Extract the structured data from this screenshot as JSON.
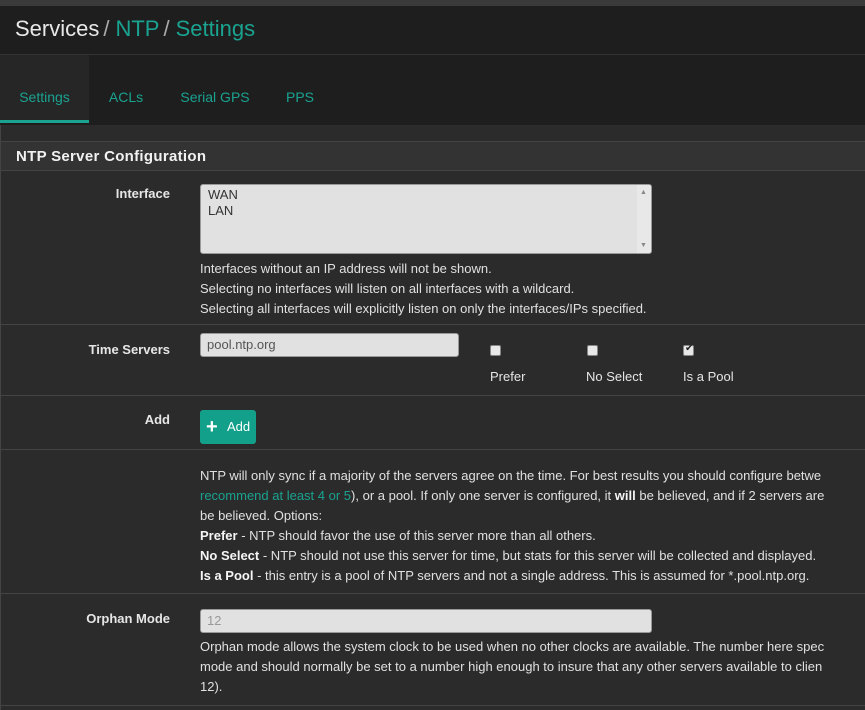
{
  "breadcrumb": {
    "root": "Services",
    "sep1": "/",
    "ntp": "NTP",
    "sep2": "/",
    "settings": "Settings"
  },
  "tabs": [
    "Settings",
    "ACLs",
    "Serial GPS",
    "PPS"
  ],
  "panel_title": "NTP Server Configuration",
  "interface": {
    "label": "Interface",
    "options": [
      "WAN",
      "LAN"
    ],
    "help": [
      "Interfaces without an IP address will not be shown.",
      "Selecting no interfaces will listen on all interfaces with a wildcard.",
      "Selecting all interfaces will explicitly listen on only the interfaces/IPs specified."
    ]
  },
  "time_servers": {
    "label": "Time Servers",
    "value": "pool.ntp.org",
    "prefer_label": "Prefer",
    "noselect_label": "No Select",
    "pool_label": "Is a Pool",
    "prefer_checked": false,
    "noselect_checked": false,
    "pool_checked": true
  },
  "add": {
    "label": "Add",
    "button": "Add",
    "icon": "plus-icon"
  },
  "ntp_help": {
    "line1": "NTP will only sync if a majority of the servers agree on the time. For best results you should configure betwe",
    "line2_link": "recommend at least 4 or 5",
    "line2_rest_a": "), or a pool. If only one server is configured, it ",
    "line2_bold": "will",
    "line2_rest_b": " be believed, and if 2 servers are",
    "line3": "be believed. Options:",
    "prefer_b": "Prefer",
    "prefer_t": " - NTP should favor the use of this server more than all others.",
    "noselect_b": "No Select",
    "noselect_t": " - NTP should not use this server for time, but stats for this server will be collected and displayed.",
    "pool_b": "Is a Pool",
    "pool_t": " - this entry is a pool of NTP servers and not a single address. This is assumed for *.pool.ntp.org."
  },
  "orphan": {
    "label": "Orphan Mode",
    "placeholder": "12",
    "help1": "Orphan mode allows the system clock to be used when no other clocks are available. The number here spec",
    "help2": "mode and should normally be set to a number high enough to insure that any other servers available to clien",
    "help3": "12)."
  },
  "colors": {
    "accent": "#1aa390",
    "button": "#12a08a",
    "panel": "#2b2b2b",
    "heading": "#333333"
  }
}
